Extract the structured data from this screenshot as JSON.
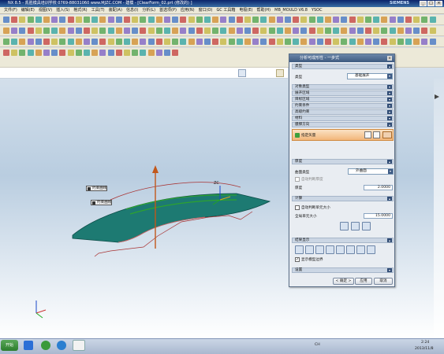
{
  "window": {
    "title": "NX 8.5 - 凯胜模具培训学校 0769-88031060 www.MJZC.COM - 建模 - [ClearForm_02.prt (修改的) ]",
    "brand": "SIEMENS"
  },
  "menu": [
    "文件(F)",
    "编辑(E)",
    "视图(V)",
    "插入(S)",
    "格式(R)",
    "工具(T)",
    "装配(A)",
    "信息(I)",
    "分析(L)",
    "首选项(P)",
    "应用(N)",
    "窗口(O)",
    "GC 工具箱",
    "电极(E)",
    "帮助(H)",
    "MB_MOULD V6.8",
    "YSOC"
  ],
  "graphics": {
    "callout1": "约束曲线",
    "callout2": "约束曲线",
    "axis_label": "ZC"
  },
  "dialog": {
    "title": "分析可成形性 - 一步式",
    "sec_type": "类型",
    "type_label": "类型",
    "type_value": "基础展开",
    "sec_object_type": "对象类型",
    "sec_expand_region": "展开区域",
    "sec_target_region": "目标区域",
    "sec_constraint": "约束条件",
    "sec_advanced": "高级约束",
    "sec_material": "材料",
    "sec_direction": "膜撑方向",
    "direction_label": "指定矢量",
    "sec_thickness": "厚度",
    "surface_type_label": "曲面类型",
    "surface_type_value": "外曲面",
    "auto_thickness_label": "自动判断厚度",
    "thickness_label": "厚度",
    "thickness_value": "2.0000",
    "sec_compute": "计算",
    "auto_mesh_label": "自动判断单元大小",
    "mesh_size_label": "全局单元大小",
    "mesh_size_value": "15.0000",
    "sec_results": "结果显示",
    "show_boundary_label": "显示模型边界",
    "sec_settings": "设置",
    "ok": "< 确定 >",
    "apply": "应用",
    "cancel": "取消"
  },
  "taskbar": {
    "start": "开始",
    "lang": "CH",
    "time": "2:24",
    "date": "2013/11/8"
  }
}
